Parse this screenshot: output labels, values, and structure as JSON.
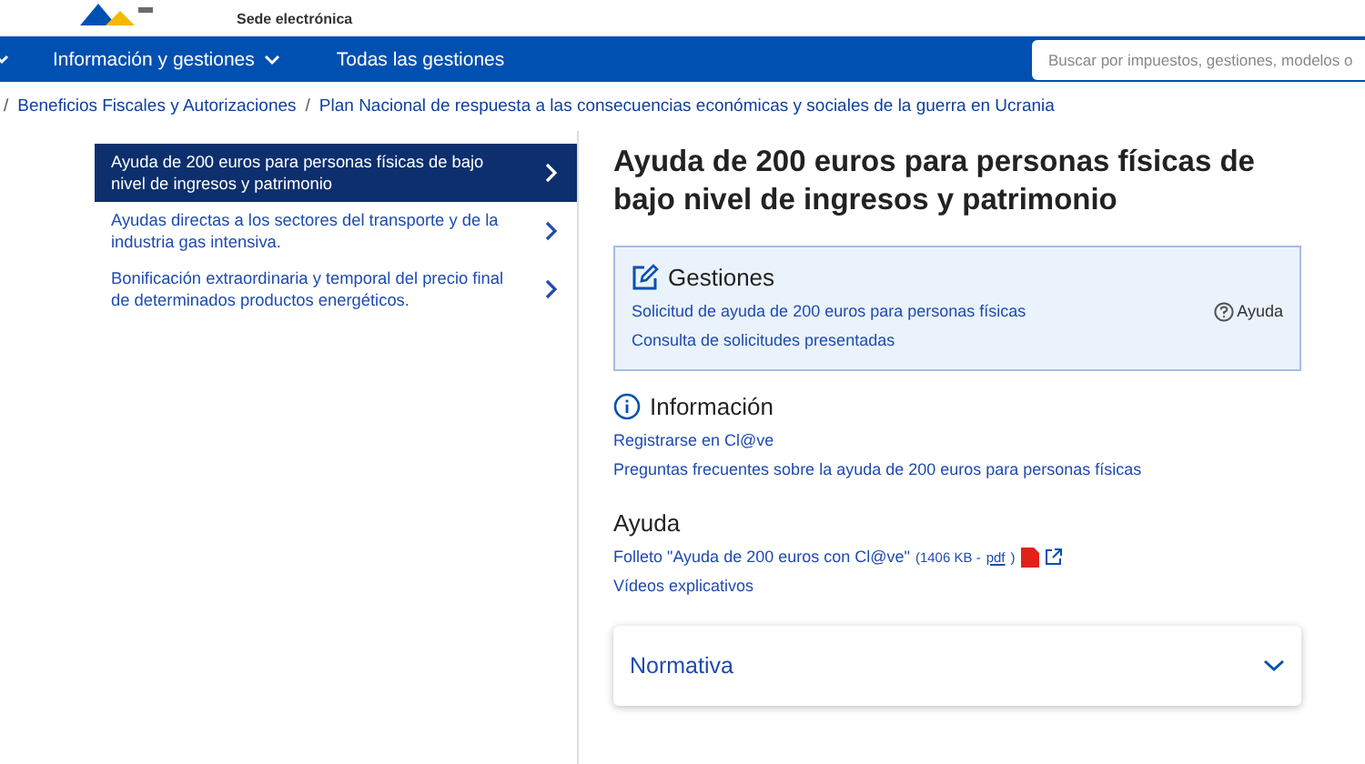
{
  "header": {
    "subtitle": "Sede electrónica"
  },
  "nav": {
    "items": [
      {
        "label": "Información y gestiones",
        "dropdown": true
      },
      {
        "label": "Todas las gestiones",
        "dropdown": false
      }
    ],
    "search": {
      "placeholder": "Buscar por impuestos, gestiones, modelos o"
    }
  },
  "breadcrumb": [
    {
      "separator": "/",
      "label": "Beneficios Fiscales y Autorizaciones"
    },
    {
      "separator": "/",
      "label": "Plan Nacional de respuesta a las consecuencias económicas y sociales de la guerra en Ucrania"
    }
  ],
  "sidebar": {
    "items": [
      {
        "label": "Ayuda de 200 euros para personas físicas de bajo nivel de ingresos y patrimonio",
        "selected": true
      },
      {
        "label": "Ayudas directas a los sectores del transporte y de la industria gas intensiva.",
        "selected": false
      },
      {
        "label": "Bonificación extraordinaria y temporal del precio final de determinados productos energéticos.",
        "selected": false
      }
    ]
  },
  "main": {
    "title": "Ayuda de 200 euros para personas físicas de bajo nivel de ingresos y patrimonio",
    "gestiones": {
      "title": "Gestiones",
      "links": [
        "Solicitud de ayuda de 200 euros para personas físicas",
        "Consulta de solicitudes presentadas"
      ],
      "help": "Ayuda"
    },
    "informacion": {
      "title": "Información",
      "links": [
        "Registrarse en Cl@ve",
        "Preguntas frecuentes sobre la ayuda de 200 euros para personas físicas"
      ]
    },
    "ayuda": {
      "title": "Ayuda",
      "file_link": "Folleto \"Ayuda de 200 euros con Cl@ve\"",
      "file_size": "(1406 KB - ",
      "file_type": "pdf",
      "file_close": ")",
      "links": [
        "Vídeos explicativos"
      ]
    },
    "accordion": {
      "title": "Normativa",
      "expanded": false
    }
  }
}
